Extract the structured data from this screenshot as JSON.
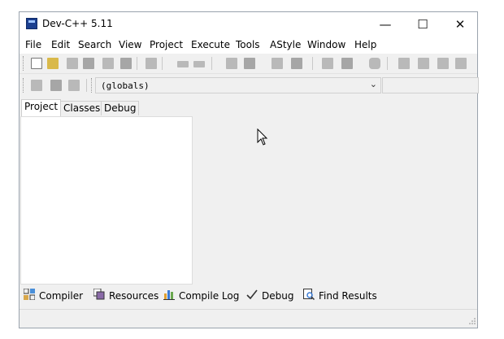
{
  "window": {
    "title": "Dev-C++ 5.11",
    "minimize": "—",
    "maximize": "☐",
    "close": "✕"
  },
  "menu": [
    "File",
    "Edit",
    "Search",
    "View",
    "Project",
    "Execute",
    "Tools",
    "AStyle",
    "Window",
    "Help"
  ],
  "toolbar2": {
    "scope_value": "(globals)"
  },
  "left_tabs": [
    "Project",
    "Classes",
    "Debug"
  ],
  "bottom_tabs": [
    "Compiler",
    "Resources",
    "Compile Log",
    "Debug",
    "Find Results"
  ],
  "colors": {
    "accent": "#1b3f8f",
    "panel": "#f0f0f0"
  }
}
